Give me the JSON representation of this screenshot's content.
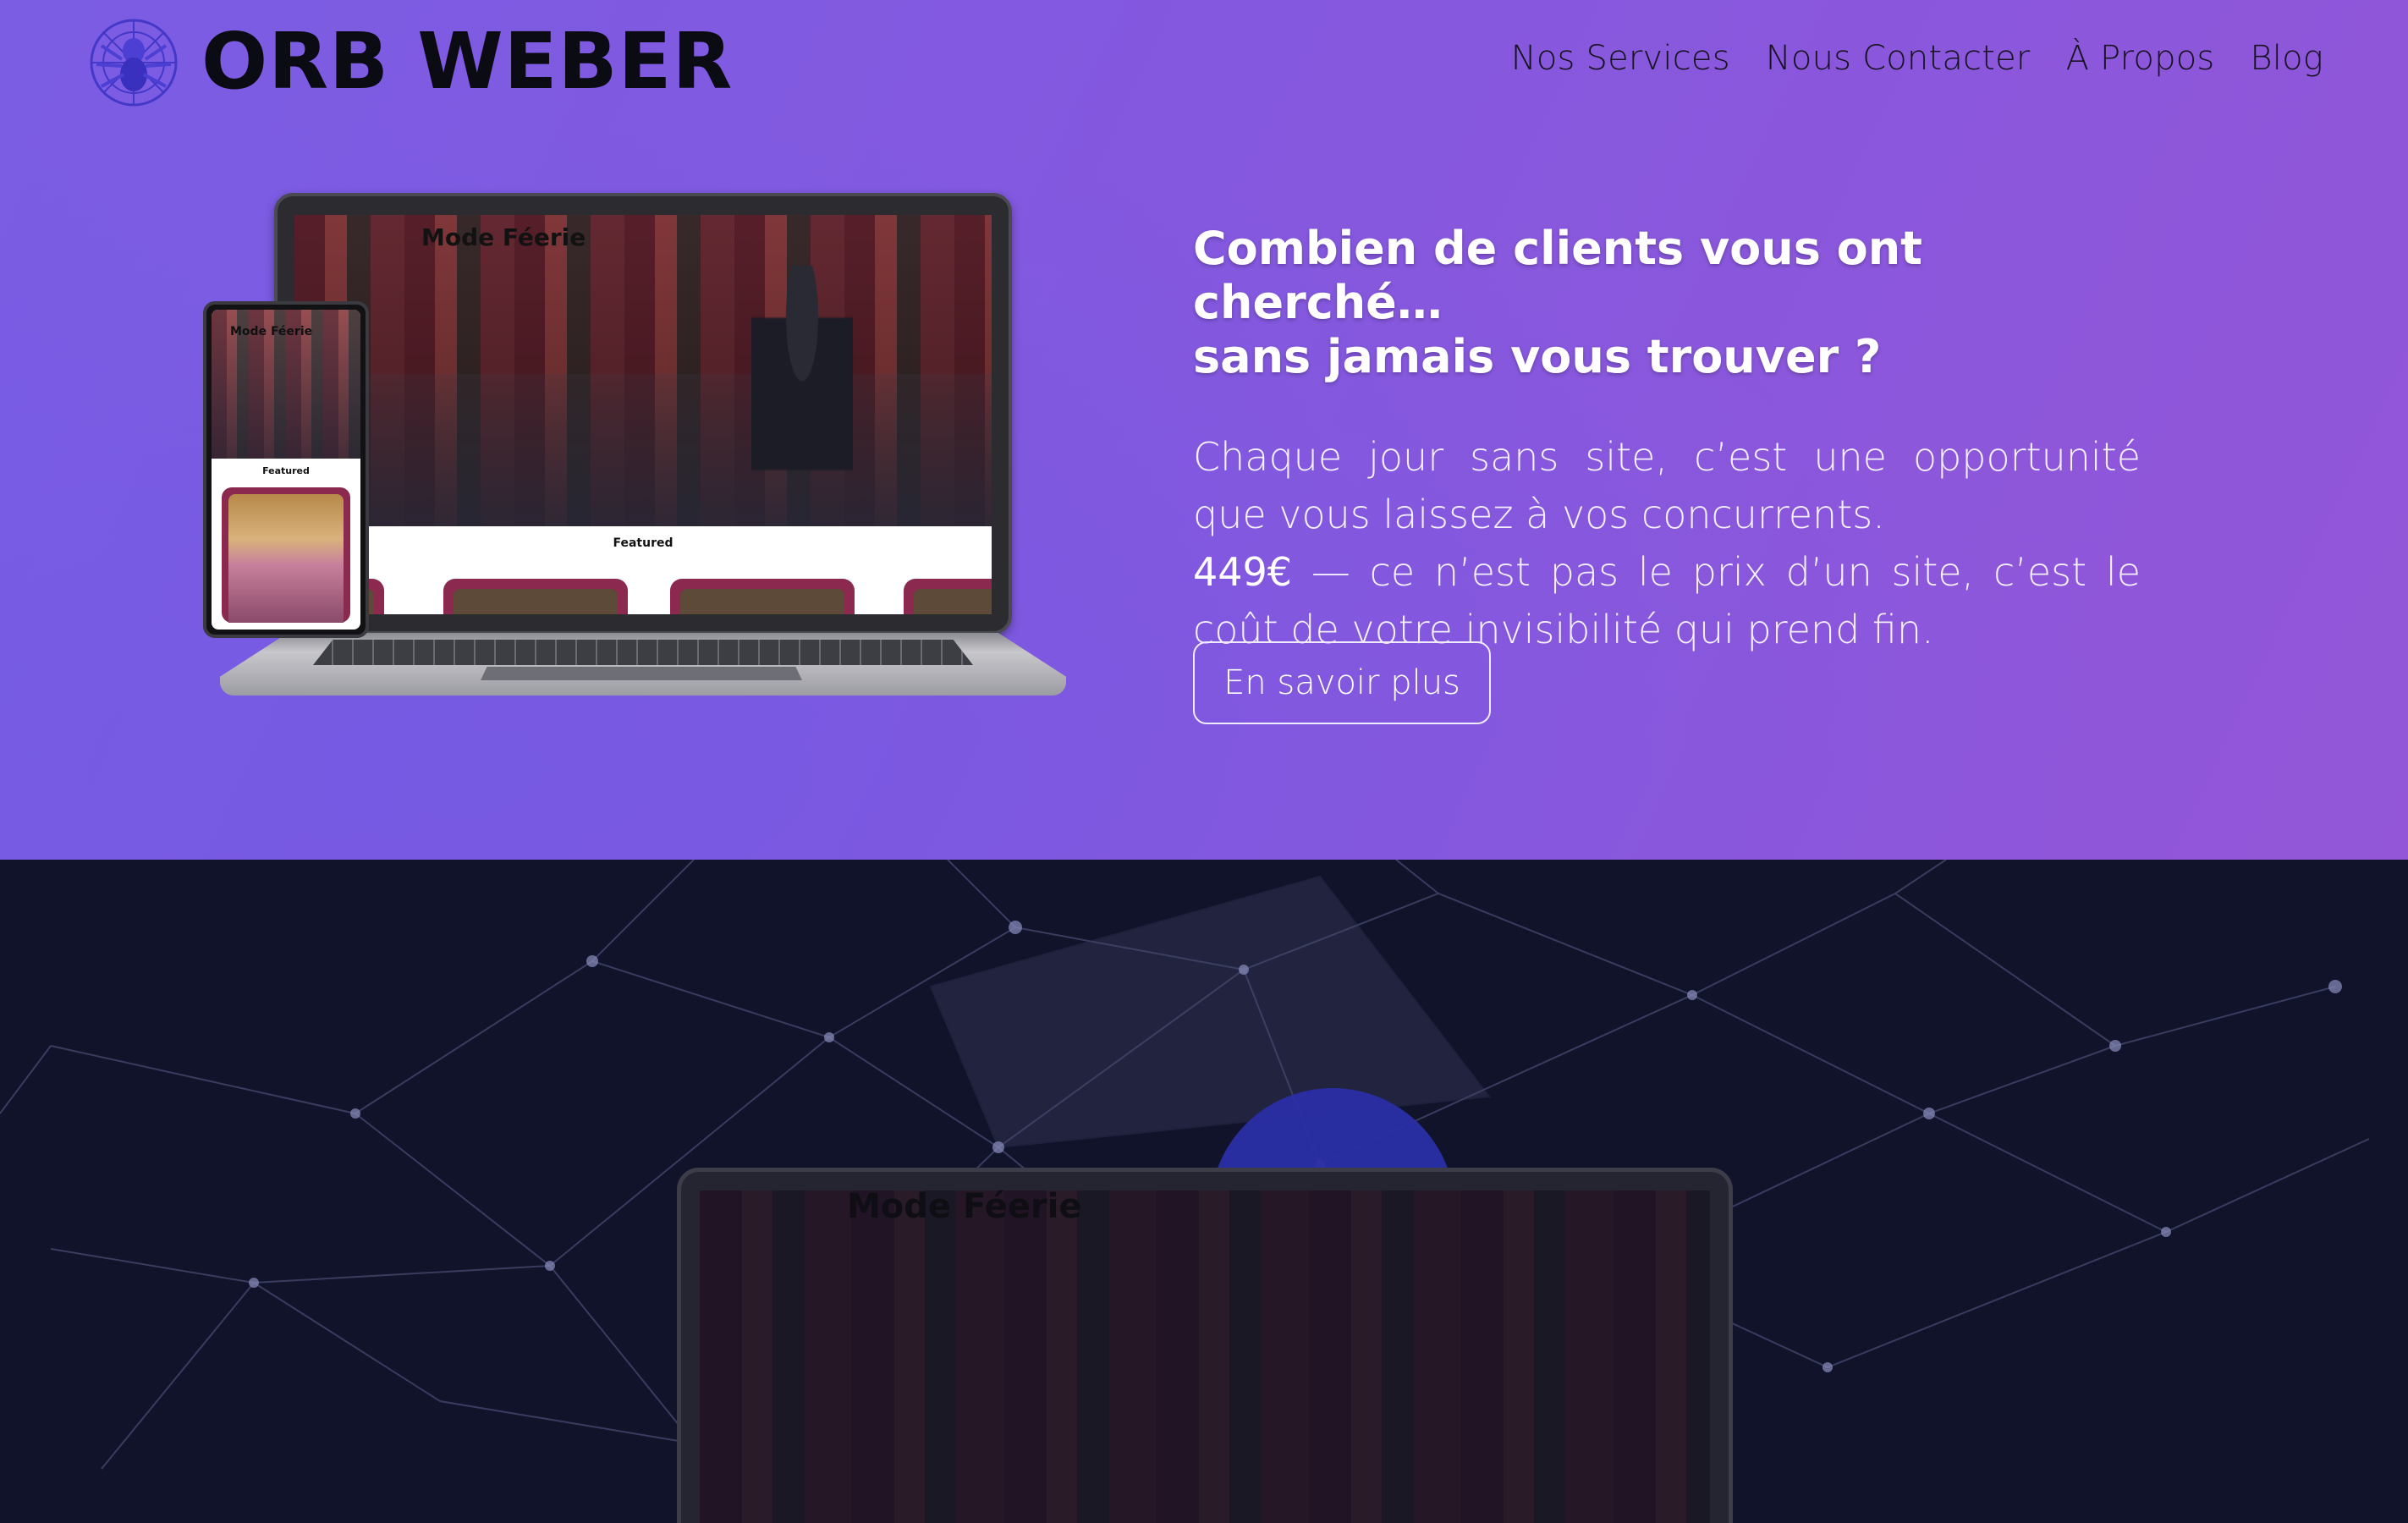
{
  "header": {
    "brand": "ORB WEBER",
    "logo_icon": "orb-spider-logo-icon",
    "nav": [
      {
        "label": "Nos Services"
      },
      {
        "label": "Nous Contacter"
      },
      {
        "label": "À Propos"
      },
      {
        "label": "Blog"
      }
    ]
  },
  "hero": {
    "title_line1": "Combien de clients vous ont cherché…",
    "title_line2": "sans jamais vous trouver ?",
    "body_line1": "Chaque jour sans site, c’est une opportunité que vous laissez à vos concurrents.",
    "price": "449€",
    "body_line2": " — ce n’est pas le prix d’un site, c’est le coût de votre invisibilité qui prend fin.",
    "cta_label": "En savoir plus"
  },
  "mockup": {
    "site_title": "Mode Féerie",
    "featured_label": "Featured",
    "phone_title": "Mode Féerie",
    "phone_featured_label": "Featured"
  },
  "lower": {
    "site_title": "Mode Féerie"
  },
  "colors": {
    "hero_gradient_start": "#7a5de3",
    "hero_gradient_end": "#9356d8",
    "dark_section": "#11132a",
    "accent_blob": "#2a2ea5",
    "card_accent": "#8b2a4e"
  }
}
